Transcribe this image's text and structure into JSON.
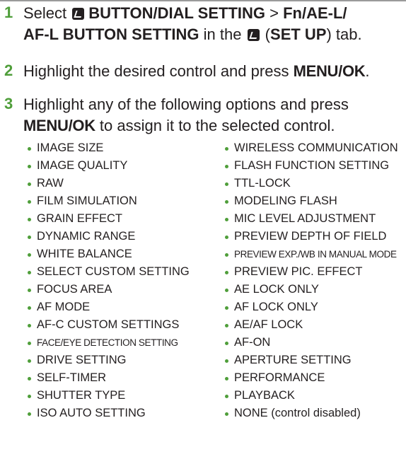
{
  "steps": [
    {
      "number": "1",
      "parts": {
        "t1": "Select ",
        "icon": "setup-tab-icon",
        "t2": "BUTTON/DIAL SETTING",
        "t3": " > ",
        "t4": "Fn/AE-L/",
        "t5": "AF-L BUTTON SETTING",
        "t6": " in the ",
        "t7": " (",
        "t8": "SET UP",
        "t9": ") tab."
      }
    },
    {
      "number": "2",
      "parts": {
        "t1": "Highlight the desired control and press ",
        "t2": "MENU/OK",
        "t3": "."
      }
    },
    {
      "number": "3",
      "parts": {
        "t1": "Highlight any of the following options and press",
        "t2": "MENU/OK",
        "t3": " to assign it to the selected control."
      }
    }
  ],
  "options_left": [
    "IMAGE SIZE",
    "IMAGE QUALITY",
    "RAW",
    "FILM SIMULATION",
    "GRAIN EFFECT",
    "DYNAMIC RANGE",
    "WHITE BALANCE",
    "SELECT CUSTOM SETTING",
    "FOCUS AREA",
    "AF MODE",
    "AF-C CUSTOM SETTINGS",
    "FACE/EYE DETECTION SETTING",
    "DRIVE SETTING",
    "SELF-TIMER",
    "SHUTTER TYPE",
    "ISO AUTO SETTING"
  ],
  "options_right": [
    "WIRELESS COMMUNICATION",
    "FLASH FUNCTION SETTING",
    "TTL-LOCK",
    "MODELING FLASH",
    "MIC LEVEL ADJUSTMENT",
    "PREVIEW DEPTH OF FIELD",
    "PREVIEW EXP./WB IN MANUAL MODE",
    "PREVIEW PIC. EFFECT",
    "AE LOCK ONLY",
    "AF LOCK ONLY",
    "AE/AF LOCK",
    "AF-ON",
    "APERTURE SETTING",
    "PERFORMANCE",
    "PLAYBACK",
    "NONE (control disabled)"
  ],
  "colors": {
    "step_number": "#4f9e3a",
    "bullet": "#4f9e3a",
    "text": "#231f20"
  }
}
